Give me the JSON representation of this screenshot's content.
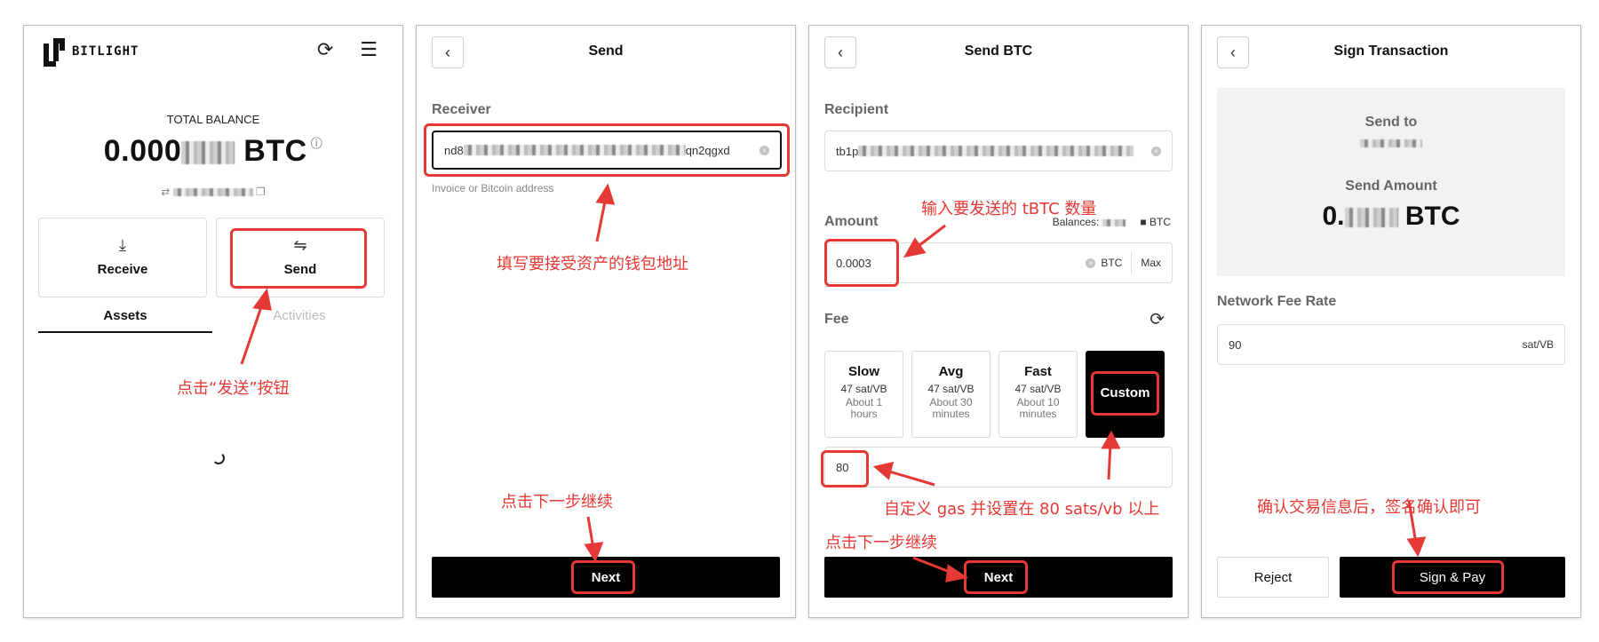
{
  "panel1": {
    "logo_text": "BITLIGHT",
    "total_label": "TOTAL BALANCE",
    "total_prefix": "0.000",
    "total_unit": "BTC",
    "receive_label": "Receive",
    "send_label": "Send",
    "tab_assets": "Assets",
    "tab_activities": "Activities",
    "annotation": "点击“发送”按钮"
  },
  "panel2": {
    "title": "Send",
    "receiver_label": "Receiver",
    "receiver_value_start": "nd8",
    "receiver_value_end": "qn2qgxd",
    "receiver_hint": "Invoice or Bitcoin address",
    "annotation_address": "填写要接受资产的钱包地址",
    "annotation_next": "点击下一步继续",
    "next_label": "Next"
  },
  "panel3": {
    "title": "Send BTC",
    "recipient_label": "Recipient",
    "recipient_value_start": "tb1p",
    "amount_label": "Amount",
    "balances_label": "Balances:",
    "balances_unit": "BTC",
    "amount_value": "0.0003",
    "amount_unit": "BTC",
    "max_label": "Max",
    "fee_label": "Fee",
    "fee_options": [
      {
        "title": "Slow",
        "rate": "47 sat/VB",
        "eta": "About 1 hours"
      },
      {
        "title": "Avg",
        "rate": "47 sat/VB",
        "eta": "About 30 minutes"
      },
      {
        "title": "Fast",
        "rate": "47 sat/VB",
        "eta": "About 10 minutes"
      }
    ],
    "custom_label": "Custom",
    "custom_fee_value": "80",
    "next_label": "Next",
    "annotation_amount": "输入要发送的 tBTC 数量",
    "annotation_gas": "自定义 gas 并设置在 80 sats/vb 以上",
    "annotation_next": "点击下一步继续"
  },
  "panel4": {
    "title": "Sign Transaction",
    "send_to_label": "Send to",
    "send_amount_label": "Send Amount",
    "amount_prefix": "0.",
    "amount_unit": "BTC",
    "fee_rate_label": "Network Fee Rate",
    "fee_rate_value": "90",
    "fee_rate_unit": "sat/VB",
    "reject_label": "Reject",
    "sign_label": "Sign & Pay",
    "annotation": "确认交易信息后，签名确认即可"
  },
  "colors": {
    "annotation_red": "#e53935",
    "primary_black": "#000000"
  }
}
